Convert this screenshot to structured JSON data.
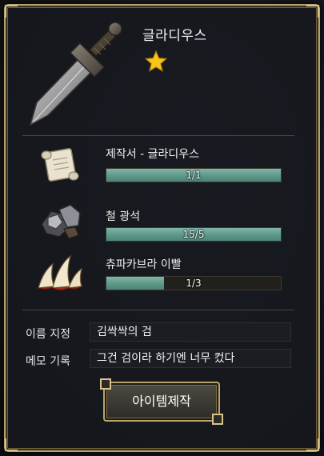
{
  "item": {
    "name": "글라디우스",
    "rarity_stars": 1,
    "icon": "sword-icon"
  },
  "materials": [
    {
      "name": "제작서 - 글라디우스",
      "progress_text": "1/1",
      "fill": 1.0,
      "icon": "scroll-icon"
    },
    {
      "name": "철 광석",
      "progress_text": "15/5",
      "fill": 1.0,
      "icon": "iron-ore-icon"
    },
    {
      "name": "츄파카브라 이빨",
      "progress_text": "1/3",
      "fill": 0.33,
      "icon": "fang-icon"
    }
  ],
  "fields": {
    "name_label": "이름 지정",
    "name_value": "김싹싹의 검",
    "memo_label": "메모 기록",
    "memo_value": "그건 검이라 하기엔 너무 컸다"
  },
  "craft_button": {
    "label": "아이템제작"
  },
  "colors": {
    "frame": "#b9a36a",
    "bar_fill": "#5a9586",
    "star": "#f5c518"
  }
}
